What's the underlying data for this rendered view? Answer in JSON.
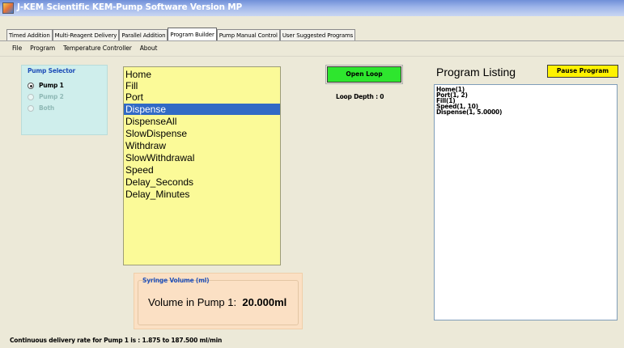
{
  "window": {
    "title": "J-KEM Scientific KEM-Pump Software   Version MP"
  },
  "tabs": [
    {
      "label": "Timed Addition",
      "active": false
    },
    {
      "label": "Multi-Reagent Delivery",
      "active": false
    },
    {
      "label": "Parallel Addition",
      "active": false
    },
    {
      "label": "Program Builder",
      "active": true
    },
    {
      "label": "Pump Manual Control",
      "active": false
    },
    {
      "label": "User Suggested Programs",
      "active": false
    }
  ],
  "menu": {
    "file": "File",
    "program": "Program",
    "temperature_controller": "Temperature Controller",
    "about": "About"
  },
  "pump_selector": {
    "title": "Pump Selector",
    "options": [
      {
        "label": "Pump 1",
        "checked": true,
        "enabled": true
      },
      {
        "label": "Pump 2",
        "checked": false,
        "enabled": false
      },
      {
        "label": "Both",
        "checked": false,
        "enabled": false
      }
    ]
  },
  "commands": {
    "items": [
      "Home",
      "Fill",
      "Port",
      "Dispense",
      "DispenseAll",
      "SlowDispense",
      "Withdraw",
      "SlowWithdrawal",
      "Speed",
      "Delay_Seconds",
      "Delay_Minutes"
    ],
    "selected": "Dispense"
  },
  "loop": {
    "button_label": "Open Loop",
    "depth_text": "Loop Depth : 0"
  },
  "program_listing": {
    "label": "Program Listing",
    "pause_label": "Pause Program",
    "lines": [
      "Home(1)",
      "Port(1, 2)",
      "Fill(1)",
      "Speed(1, 10)",
      "Dispense(1, 5.0000)"
    ]
  },
  "syringe": {
    "title": "Syringe Volume (ml)",
    "volume_prefix": "Volume in Pump 1:",
    "volume_value": "20.000ml"
  },
  "status": {
    "delivery_rate": "Continuous delivery rate for Pump 1 is : 1.875 to 187.500 ml/min"
  },
  "colors": {
    "command_list_bg": "#fbfa98",
    "selection": "#316ac5",
    "open_loop_bg": "#2ee62e",
    "pause_bg": "#fff200",
    "pump_selector_bg": "#cfeeec",
    "syringe_bg": "#fbe0c4",
    "group_title": "#1f4fb8"
  }
}
